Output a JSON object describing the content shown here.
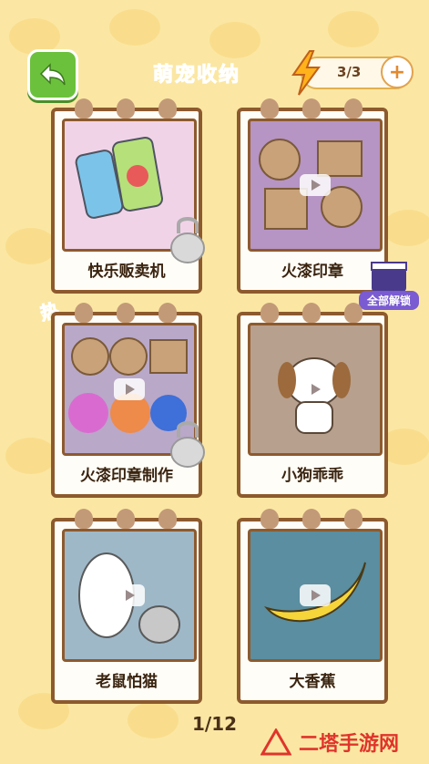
{
  "header": {
    "title": "萌宠收纳",
    "energy": "3/3",
    "plus": "+"
  },
  "badges": {
    "hot": "热",
    "unlock_all": "全部解锁"
  },
  "cards": [
    {
      "label": "快乐贩卖机",
      "locked": true
    },
    {
      "label": "火漆印章",
      "locked": false
    },
    {
      "label": "火漆印章制作",
      "locked": true
    },
    {
      "label": "小狗乖乖",
      "locked": false
    },
    {
      "label": "老鼠怕猫",
      "locked": false
    },
    {
      "label": "大香蕉",
      "locked": false
    }
  ],
  "pager": "1/12",
  "watermark": "二塔手游网",
  "icons": [
    "back-arrow-icon",
    "lightning-icon",
    "plus-icon",
    "play-icon",
    "lock-icon",
    "clapper-icon"
  ],
  "colors": {
    "background": "#fbe7a3",
    "card_border": "#8d5a2e",
    "back_button": "#6cc13c",
    "title": "#8b4a16",
    "hot": "#e5352b"
  }
}
